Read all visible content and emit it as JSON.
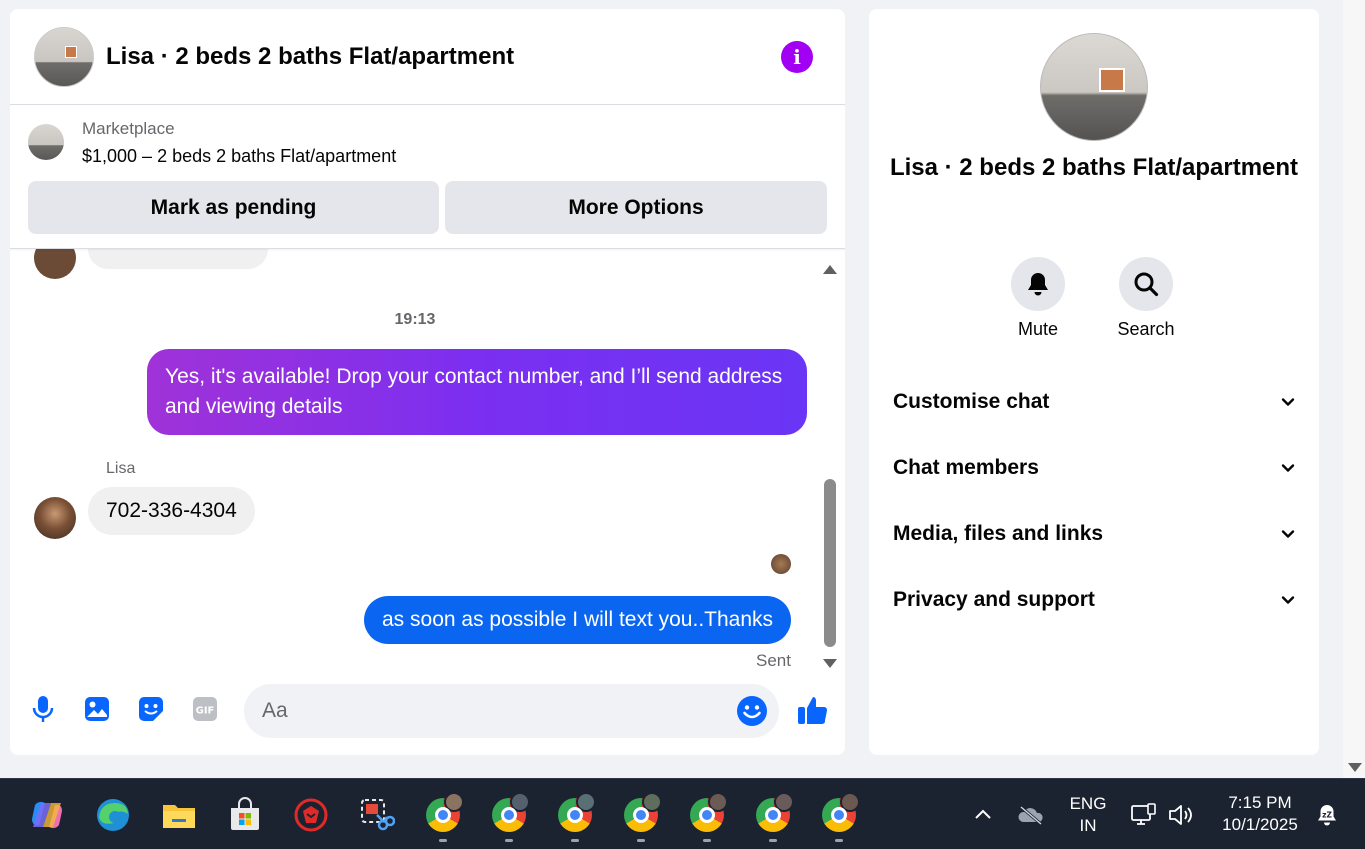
{
  "chat": {
    "title": "Lisa · 2 beds 2 baths Flat/apartment",
    "info_icon": "info-icon",
    "marketplace": {
      "label": "Marketplace",
      "listing": "$1,000 – 2 beds 2 baths Flat/apartment",
      "pending_button": "Mark as pending",
      "more_button": "More Options"
    },
    "messages": {
      "timestamp": "19:13",
      "outgoing_1": "Yes, it's available! Drop your contact number, and I’ll send address and viewing details",
      "sender_name": "Lisa",
      "incoming_1": "702-336-4304",
      "outgoing_2": "as soon as possible I will text you..Thanks",
      "status": "Sent"
    },
    "composer": {
      "placeholder": "Aa",
      "gif_label": "GIF",
      "icons": [
        "microphone-icon",
        "image-icon",
        "sticker-icon",
        "gif-icon",
        "emoji-icon",
        "thumbs-up-icon"
      ]
    }
  },
  "info_panel": {
    "name": "Lisa · 2 beds 2 baths Flat/apartment",
    "actions": [
      {
        "label": "Mute",
        "icon": "bell-icon"
      },
      {
        "label": "Search",
        "icon": "search-icon"
      }
    ],
    "sections": [
      "Customise chat",
      "Chat members",
      "Media, files and links",
      "Privacy and support"
    ]
  },
  "taskbar": {
    "language": "ENG",
    "region": "IN",
    "time": "7:15 PM",
    "date": "10/1/2025"
  },
  "colors": {
    "accent_purple": "#a100f2",
    "outgoing_gradient_start": "#a032d8",
    "outgoing_blue": "#0a66f0",
    "messenger_blue": "#0866ff"
  }
}
